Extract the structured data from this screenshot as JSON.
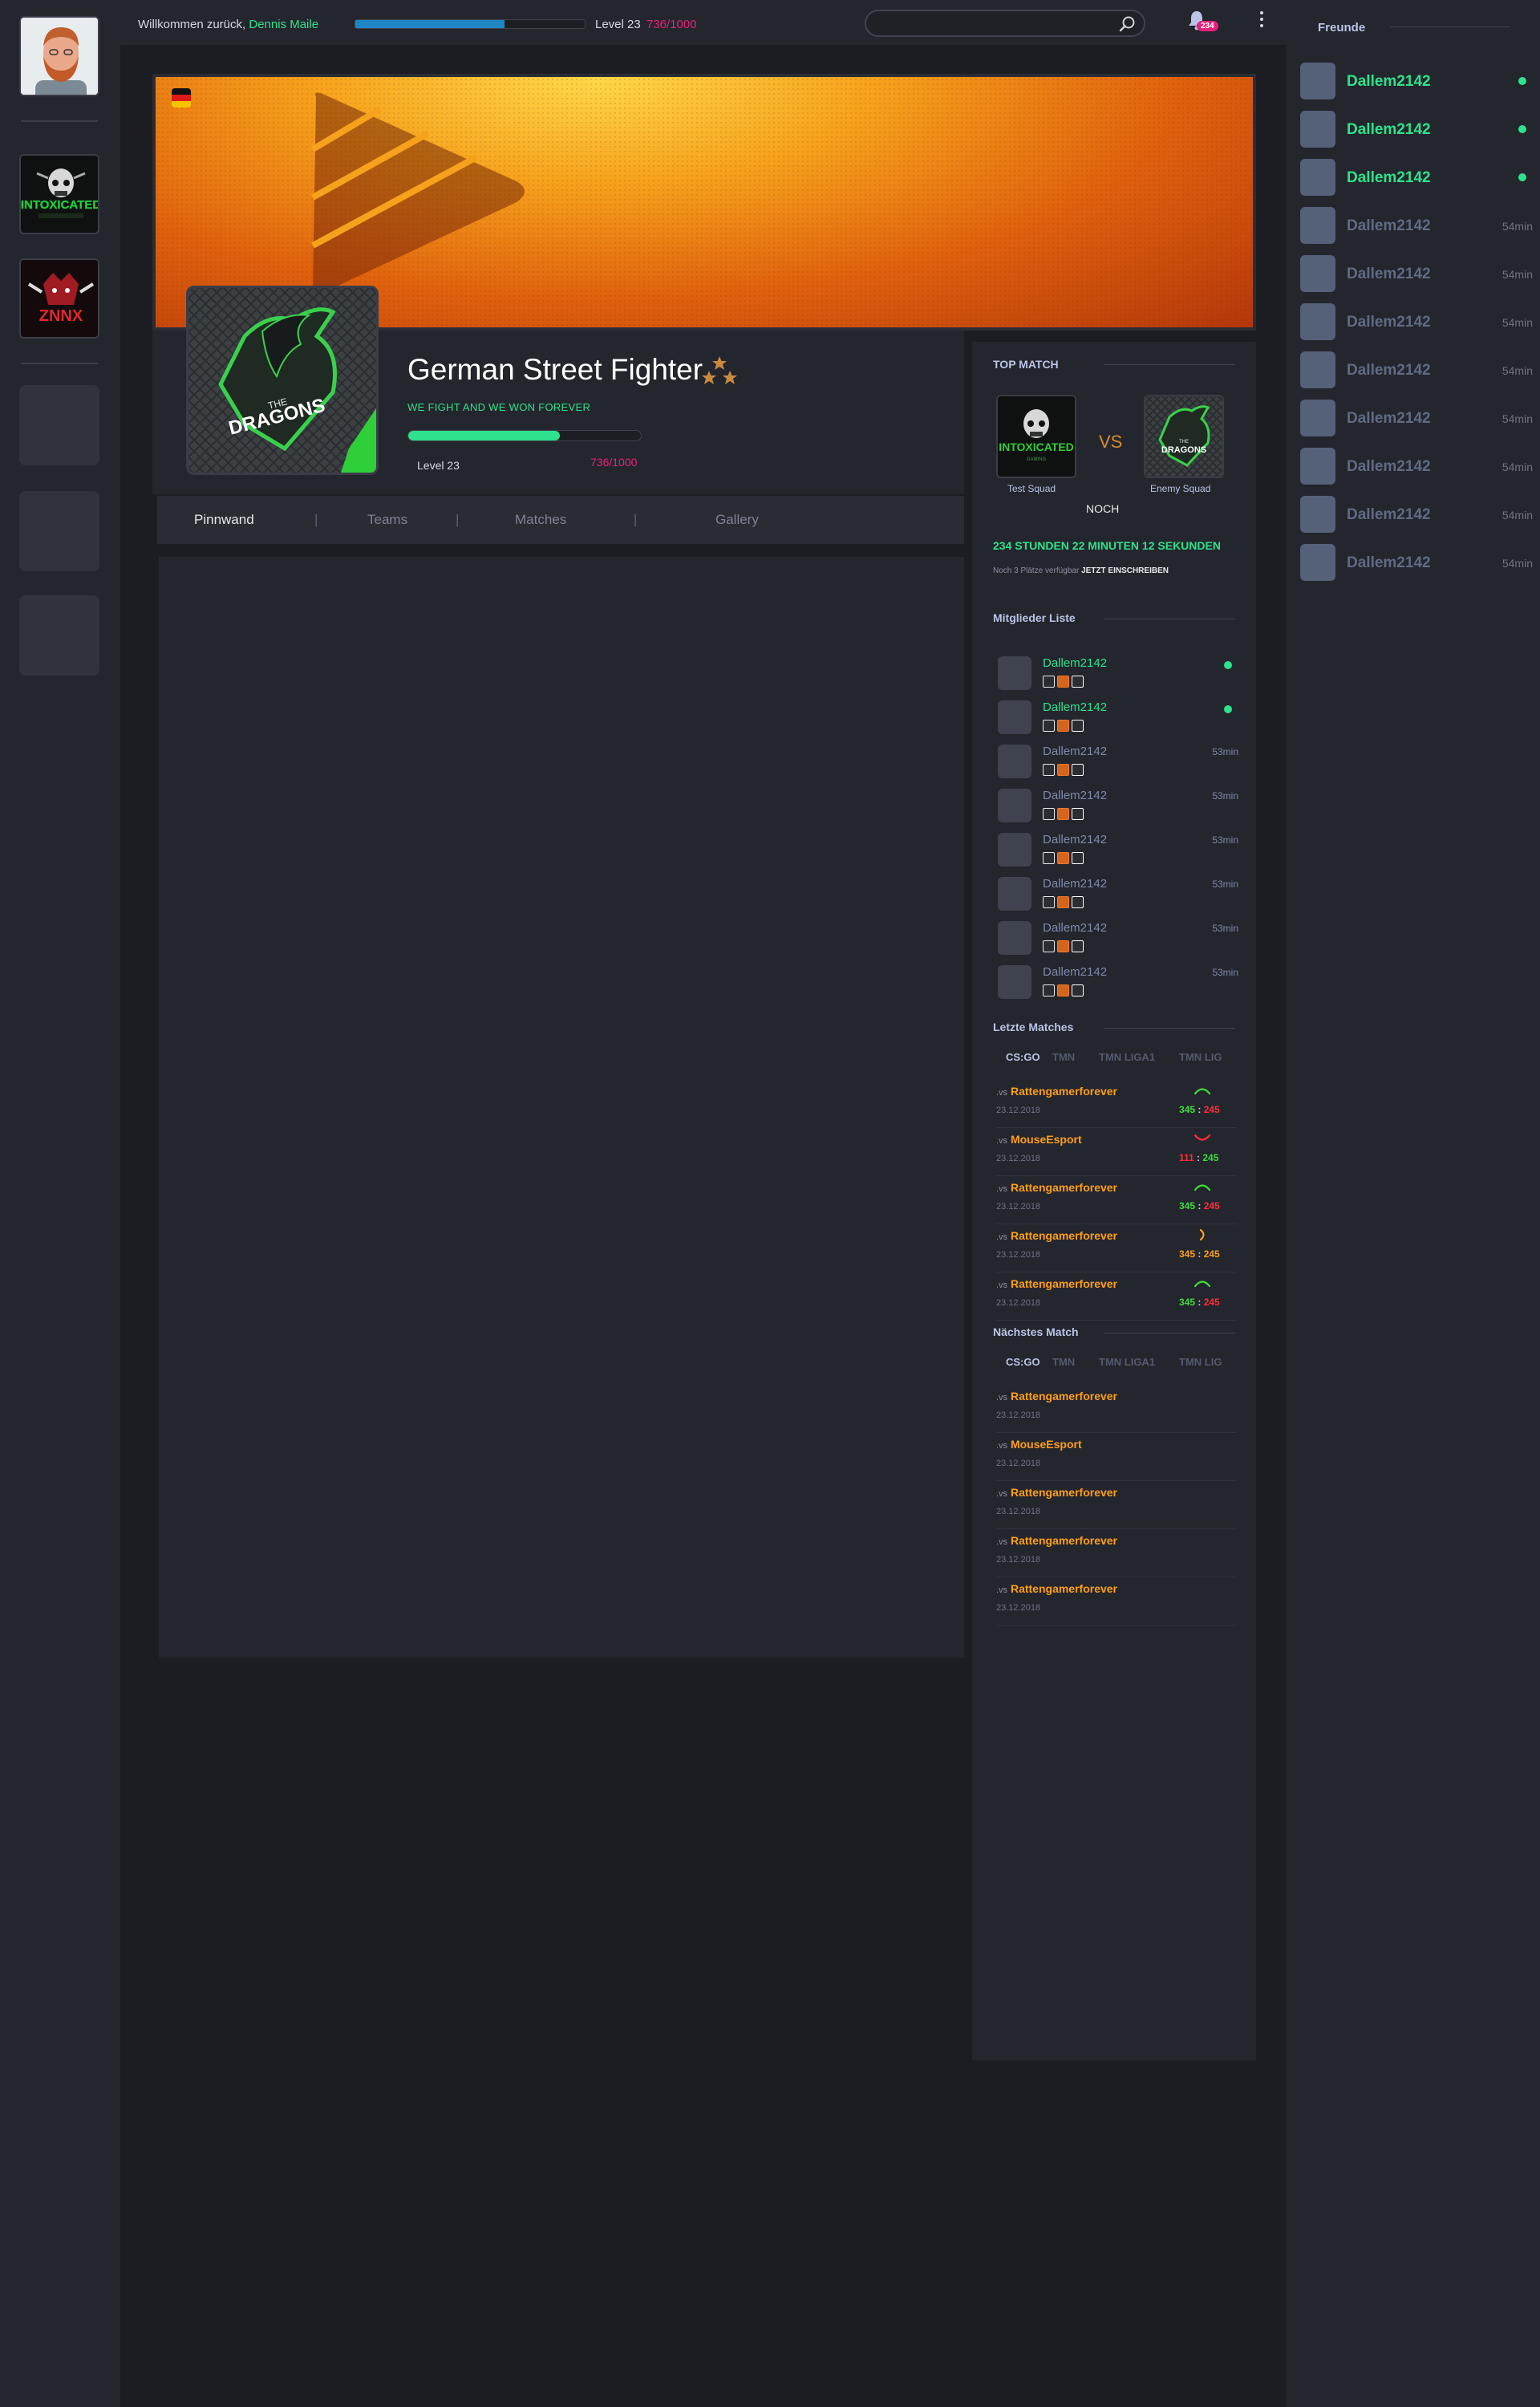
{
  "header": {
    "welcome": "Willkommen zurück,",
    "user_name": "Dennis Maile",
    "level": "Level 23",
    "xp": "736/1000",
    "xp_fraction": 0.65,
    "search_placeholder": "",
    "notification_count": "234"
  },
  "team": {
    "name": "German Street Fighter",
    "motto": "WE FIGHT AND WE WON FOREVER",
    "level": "Level 23",
    "xp": "736/1000",
    "xp_fraction": 0.65,
    "logo_text_top": "THE",
    "logo_text_bottom": "DRAGONS"
  },
  "tabs": [
    "Pinnwand",
    "Teams",
    "Matches",
    "Gallery"
  ],
  "top_match": {
    "title": "TOP MATCH",
    "vs": "VS",
    "team_a": "Test Squad",
    "team_b": "Enemy Squad",
    "team_a_logo": "INTOXICATED",
    "team_a_logo_sub": "GAMING",
    "team_b_logo_top": "THE",
    "team_b_logo": "DRAGONS",
    "noch": "NOCH",
    "countdown": "234 STUNDEN 22 MINUTEN 12 SEKUNDEN",
    "places": "Noch 3 Plätze verfügbar",
    "signup": "JETZT EINSCHREIBEN"
  },
  "members": {
    "title": "Mitglieder Liste",
    "list": [
      {
        "name": "Dallem2142",
        "online": true,
        "time": ""
      },
      {
        "name": "Dallem2142",
        "online": true,
        "time": ""
      },
      {
        "name": "Dallem2142",
        "online": false,
        "time": "53min"
      },
      {
        "name": "Dallem2142",
        "online": false,
        "time": "53min"
      },
      {
        "name": "Dallem2142",
        "online": false,
        "time": "53min"
      },
      {
        "name": "Dallem2142",
        "online": false,
        "time": "53min"
      },
      {
        "name": "Dallem2142",
        "online": false,
        "time": "53min"
      },
      {
        "name": "Dallem2142",
        "online": false,
        "time": "53min"
      }
    ]
  },
  "last_matches": {
    "title": "Letzte Matches",
    "tabs": [
      "CS:GO",
      "TMN",
      "TMN LIGA1",
      "TMN LIG"
    ],
    "list": [
      {
        "vs": ".vs",
        "opponent": "Rattengamerforever",
        "date": "23.12.2018",
        "score_a": "345",
        "score_b": "245",
        "result": "win"
      },
      {
        "vs": ".vs",
        "opponent": "MouseEsport",
        "date": "23.12.2018",
        "score_a": "111",
        "score_b": "245",
        "result": "loss"
      },
      {
        "vs": ".vs",
        "opponent": "Rattengamerforever",
        "date": "23.12.2018",
        "score_a": "345",
        "score_b": "245",
        "result": "win"
      },
      {
        "vs": ".vs",
        "opponent": "Rattengamerforever",
        "date": "23.12.2018",
        "score_a": "345",
        "score_b": "245",
        "result": "draw"
      },
      {
        "vs": ".vs",
        "opponent": "Rattengamerforever",
        "date": "23.12.2018",
        "score_a": "345",
        "score_b": "245",
        "result": "win"
      }
    ]
  },
  "next_match": {
    "title": "Nächstes Match",
    "tabs": [
      "CS:GO",
      "TMN",
      "TMN LIGA1",
      "TMN LIG"
    ],
    "list": [
      {
        "vs": ".vs",
        "opponent": "Rattengamerforever",
        "date": "23.12.2018"
      },
      {
        "vs": ".vs",
        "opponent": "MouseEsport",
        "date": "23.12.2018"
      },
      {
        "vs": ".vs",
        "opponent": "Rattengamerforever",
        "date": "23.12.2018"
      },
      {
        "vs": ".vs",
        "opponent": "Rattengamerforever",
        "date": "23.12.2018"
      },
      {
        "vs": ".vs",
        "opponent": "Rattengamerforever",
        "date": "23.12.2018"
      }
    ]
  },
  "friends": {
    "title": "Freunde",
    "list": [
      {
        "name": "Dallem2142",
        "online": true,
        "time": ""
      },
      {
        "name": "Dallem2142",
        "online": true,
        "time": ""
      },
      {
        "name": "Dallem2142",
        "online": true,
        "time": ""
      },
      {
        "name": "Dallem2142",
        "online": false,
        "time": "54min"
      },
      {
        "name": "Dallem2142",
        "online": false,
        "time": "54min"
      },
      {
        "name": "Dallem2142",
        "online": false,
        "time": "54min"
      },
      {
        "name": "Dallem2142",
        "online": false,
        "time": "54min"
      },
      {
        "name": "Dallem2142",
        "online": false,
        "time": "54min"
      },
      {
        "name": "Dallem2142",
        "online": false,
        "time": "54min"
      },
      {
        "name": "Dallem2142",
        "online": false,
        "time": "54min"
      },
      {
        "name": "Dallem2142",
        "online": false,
        "time": "54min"
      }
    ]
  },
  "sidebar": {
    "team_1_logo": "INTOXICATED",
    "team_2_logo": "ZNNX"
  },
  "colors": {
    "accent_green": "#2fe28c",
    "accent_pink": "#e8207a",
    "accent_blue": "#1f86c4",
    "accent_orange": "#ff9f1a",
    "loss_red": "#ff2d3a",
    "win_green": "#3ddc3a"
  }
}
